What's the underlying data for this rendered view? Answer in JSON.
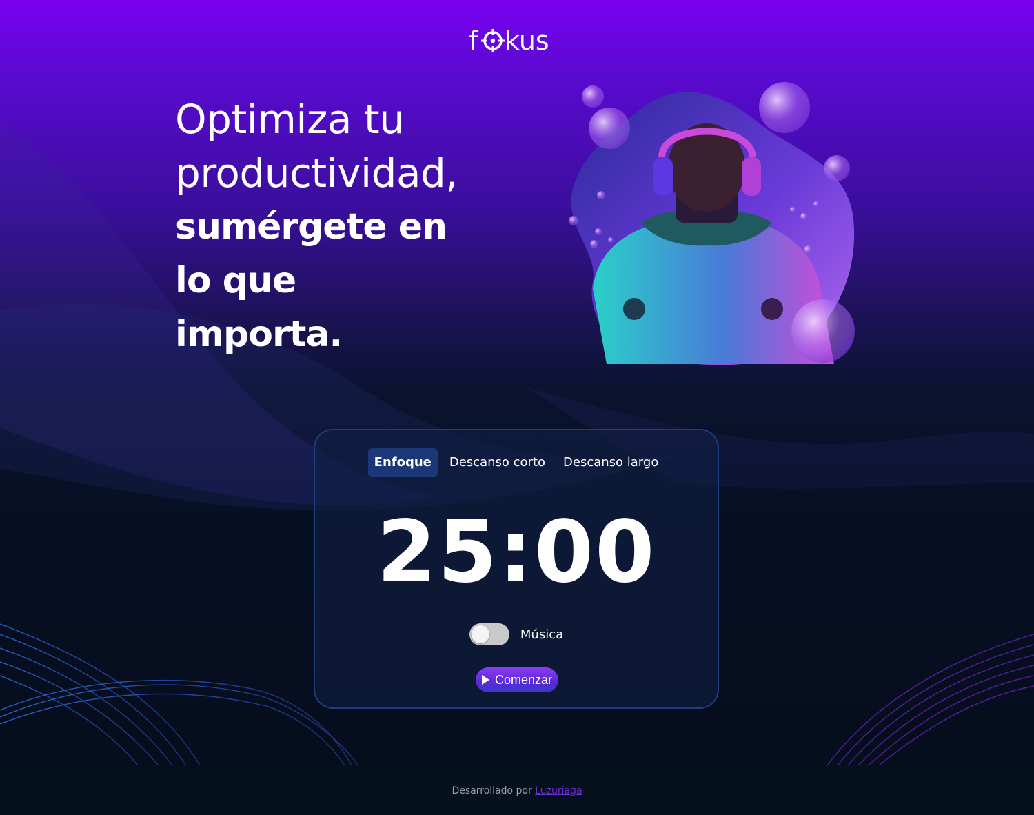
{
  "brand": {
    "logo_text_left": "f",
    "logo_text_right": "kus"
  },
  "hero": {
    "line1": "Optimiza tu",
    "line2": "productividad,",
    "line3": "sumérgete en",
    "line4": "lo que",
    "line5": "importa.",
    "image_icon": "man-with-headphones-illustration"
  },
  "timer_card": {
    "tabs": [
      {
        "label": "Enfoque",
        "active": true
      },
      {
        "label": "Descanso corto",
        "active": false
      },
      {
        "label": "Descanso largo",
        "active": false
      }
    ],
    "time": "25:00",
    "music_label": "Música",
    "music_enabled": false,
    "start_label": "Comenzar",
    "start_icon": "play-icon"
  },
  "footer": {
    "text": "Desarrollado por",
    "author": "Luzuriaga"
  },
  "colors": {
    "accent": "#7a00f0",
    "card_border": "#1d3f80",
    "active_tab": "#1a3878",
    "footer_link": "#6a2fd0"
  }
}
